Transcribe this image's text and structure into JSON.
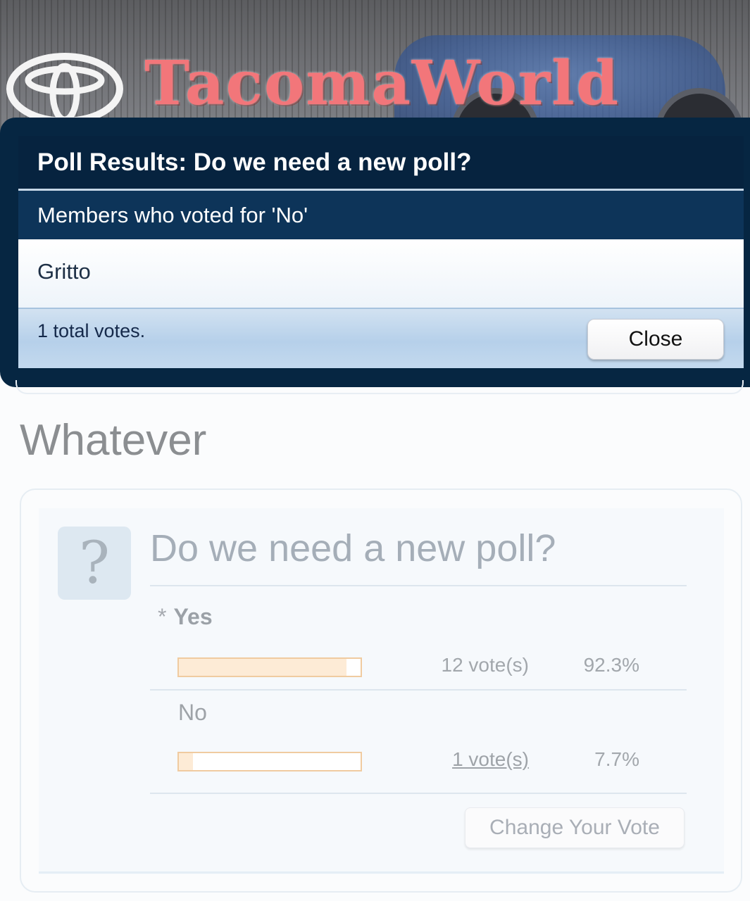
{
  "header": {
    "brand": "TacomaWorld",
    "logo_icon": "toyota-logo-icon"
  },
  "dialog": {
    "title": "Poll Results: Do we need a new poll?",
    "subtitle": "Members who voted for 'No'",
    "members": [
      "Gritto"
    ],
    "total": "1 total votes.",
    "close_label": "Close"
  },
  "thread": {
    "title": "Whatever"
  },
  "poll": {
    "icon": "?",
    "question": "Do we need a new poll?",
    "options": [
      {
        "label": "Yes",
        "marker": "*",
        "votes": "12 vote(s)",
        "percent": "92.3%",
        "fraction": 0.923
      },
      {
        "label": "No",
        "marker": "",
        "votes": "1 vote(s)",
        "percent": "7.7%",
        "fraction": 0.077
      }
    ],
    "change_vote_label": "Change Your Vote"
  },
  "colors": {
    "dialog_bg": "#062642",
    "bar_border": "#f0cba0",
    "bar_fill": "#fdebd6",
    "brand_text": "#f2767a"
  }
}
